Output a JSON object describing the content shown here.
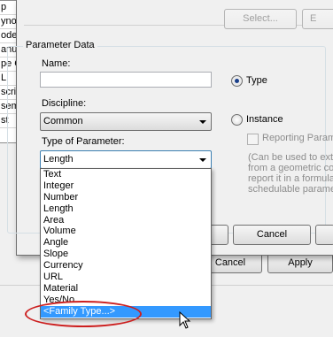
{
  "background_dialog": {
    "list_items": [
      "p",
      "ynonyn",
      "ode",
      "anufacturer",
      "pe Comments",
      "L",
      "scription",
      "sembly",
      "st"
    ],
    "cancel_label": "Cancel",
    "apply_label": "Apply"
  },
  "dialog": {
    "select_label": "Select...",
    "export_label": "E",
    "group_title": "Parameter Data",
    "name_label": "Name:",
    "name_value": "",
    "discipline_label": "Discipline:",
    "discipline_value": "Common",
    "type_of_parameter_label": "Type of Parameter:",
    "type_of_parameter_value": "Length",
    "type_radio_label": "Type",
    "instance_radio_label": "Instance",
    "reporting_label": "Reporting Parame",
    "help_lines": [
      "(Can be used to ext",
      "from a geometric co",
      "report it in a formula",
      "schedulable parame"
    ],
    "ok_label": "",
    "cancel_label": "Cancel",
    "third_label": ""
  },
  "dropdown": {
    "items": [
      "Text",
      "Integer",
      "Number",
      "Length",
      "Area",
      "Volume",
      "Angle",
      "Slope",
      "Currency",
      "URL",
      "Material",
      "Yes/No",
      "<Family Type...>"
    ],
    "selected_index": 12
  },
  "colors": {
    "selection": "#3399ff",
    "annotation": "#cc1f1f",
    "radio_dot": "#1a3f8a"
  }
}
